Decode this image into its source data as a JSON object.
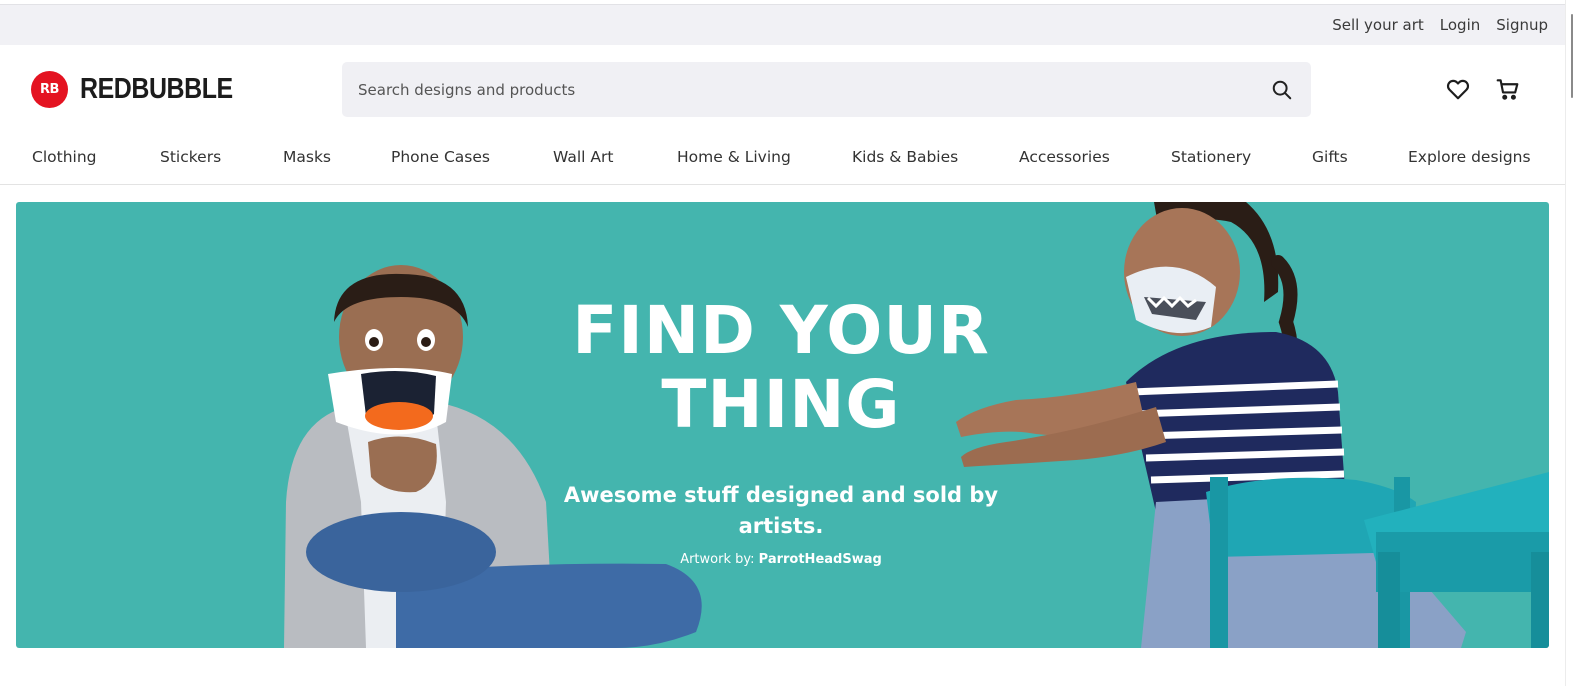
{
  "topbar": {
    "sell_label": "Sell your art",
    "login_label": "Login",
    "signup_label": "Signup"
  },
  "header": {
    "logo_badge": "RB",
    "logo_text": "REDBUBBLE",
    "brand_color": "#e41321",
    "search_placeholder": "Search designs and products",
    "icons": [
      "search-icon",
      "heart-icon",
      "cart-icon"
    ]
  },
  "nav": {
    "items": [
      {
        "label": "Clothing"
      },
      {
        "label": "Stickers"
      },
      {
        "label": "Masks"
      },
      {
        "label": "Phone Cases"
      },
      {
        "label": "Wall Art"
      },
      {
        "label": "Home & Living"
      },
      {
        "label": "Kids & Babies"
      },
      {
        "label": "Accessories"
      },
      {
        "label": "Stationery"
      },
      {
        "label": "Gifts"
      },
      {
        "label": "Explore designs"
      }
    ]
  },
  "hero": {
    "title_line1": "FIND YOUR",
    "title_line2": "THING",
    "subtitle": "Awesome stuff designed and sold by artists.",
    "credit_prefix": "Artwork by: ",
    "credit_artist": "ParrotHeadSwag",
    "background_color": "#44b5ae"
  }
}
